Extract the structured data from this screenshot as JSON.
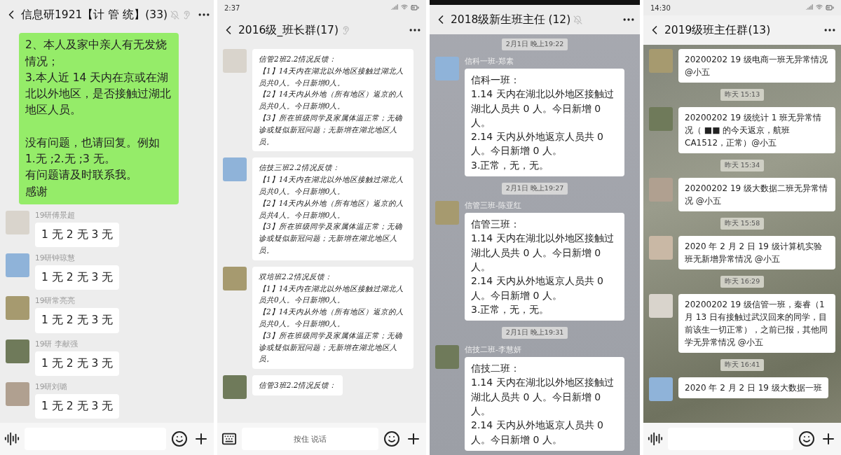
{
  "panels": [
    {
      "kind": "light",
      "title": "信息研1921【计 管 统】(33)",
      "muted": true,
      "ear": true,
      "messages": [
        {
          "kind": "outgoing",
          "paragraphs": [
            [
              "2、本人及家中亲人有无发烧情况；",
              "3.本人近 14 天内在京或在湖北以外地区，是否接触过湖北地区人员。"
            ],
            [
              "没有问题，也请回复。例如 1.无 ;2.无 ;3 无。",
              "有问题请及时联系我。",
              "感谢"
            ]
          ]
        },
        {
          "kind": "incoming",
          "sender": "19研傅景超",
          "paragraphs": [
            [
              "1 无 2 无 3 无"
            ]
          ]
        },
        {
          "kind": "incoming",
          "sender": "19研钟琼慧",
          "paragraphs": [
            [
              "1 无 2 无 3 无"
            ]
          ]
        },
        {
          "kind": "incoming",
          "sender": "19研常亮亮",
          "paragraphs": [
            [
              "1 无 2 无 3 无"
            ]
          ]
        },
        {
          "kind": "incoming",
          "sender": "19研 李献强",
          "paragraphs": [
            [
              "1 无 2 无 3 无"
            ]
          ]
        },
        {
          "kind": "incoming",
          "sender": "19研刘璐",
          "paragraphs": [
            [
              "1 无 2 无 3 无"
            ]
          ]
        }
      ],
      "input": {
        "kind": "voice"
      }
    },
    {
      "kind": "handwritten",
      "status_time": "2:37",
      "title": "2016级_班长群(17)",
      "ear": true,
      "messages": [
        {
          "kind": "incoming",
          "paragraphs": [
            [
              "信管2班2.2情况反馈：",
              "【1】14天内在湖北以外地区接触过湖北人员共0人。今日新增0人。",
              "【2】14天内从外地（所有地区）返京的人员共0人。今日新增0人。",
              "【3】所在班级同学及家属体温正常；无确诊或疑似新冠问题；无新增在湖北地区人员。"
            ]
          ]
        },
        {
          "kind": "incoming",
          "paragraphs": [
            [
              "信技三班2.2情况反馈：",
              "【1】14天内在湖北以外地区接触过湖北人员共0人。今日新增0人。",
              "【2】14天内从外地（所有地区）返京的人员共4人。今日新增0人。",
              "【3】所在班级同学及家属体温正常；无确诊或疑似新冠问题；无新增在湖北地区人员。"
            ]
          ]
        },
        {
          "kind": "incoming",
          "paragraphs": [
            [
              "双培班2.2情况反馈：",
              "【1】14天内在湖北以外地区接触过湖北人员共0人。今日新增0人。",
              "【2】14天内从外地（所有地区）返京的人员共0人。今日新增0人。",
              "【3】所在班级同学及家属体温正常；无确诊或疑似新冠问题；无新增在湖北地区人员。"
            ]
          ]
        },
        {
          "kind": "incoming",
          "paragraphs": [
            [
              "信管3班2.2情况反馈："
            ]
          ]
        }
      ],
      "input": {
        "kind": "keyboard",
        "placeholder": "按住 说话"
      }
    },
    {
      "kind": "ink",
      "title": "2018级新生班主任",
      "count": "(12)",
      "muted": true,
      "messages": [
        {
          "kind": "time",
          "text": "2月1日 晚上19:22"
        },
        {
          "kind": "incoming",
          "sender": "信科一班-郑素",
          "paragraphs": [
            [
              "信科一班：",
              "1.14 天内在湖北以外地区接触过湖北人员共 0 人。今日新增 0 人。",
              "2.14 天内从外地返京人员共 0 人。今日新增 0 人。",
              "3.正常，无，无。"
            ]
          ]
        },
        {
          "kind": "time",
          "text": "2月1日 晚上19:27"
        },
        {
          "kind": "incoming",
          "sender": "信管三班-陈亚红",
          "paragraphs": [
            [
              "信管三班：",
              "1.14 天内在湖北以外地区接触过湖北人员共 0 人。今日新增 0 人。",
              "2.14 天内从外地返京人员共 0 人。今日新增 0 人。",
              "3.正常，无，无。"
            ]
          ]
        },
        {
          "kind": "time",
          "text": "2月1日 晚上19:31"
        },
        {
          "kind": "incoming",
          "sender": "信技二班-李慧妍",
          "paragraphs": [
            [
              "信技二班：",
              "1.14 天内在湖北以外地区接触过湖北人员共 0 人。今日新增 0 人。",
              "2.14 天内从外地返京人员共 0 人。今日新增 0 人。"
            ]
          ]
        }
      ]
    },
    {
      "kind": "rain",
      "status_time": "14:30",
      "title": "2019级班主任群(13)",
      "messages": [
        {
          "kind": "incoming",
          "paragraphs": [
            [
              "20200202 19 级电商一班无异常情况 @小五"
            ]
          ]
        },
        {
          "kind": "time",
          "text": "昨天 15:13"
        },
        {
          "kind": "incoming",
          "paragraphs": [
            [
              "20200202 19 级统计 1 班无异常情况（ ■■ 的今天返京，航班 CA1512，正常）@小五"
            ]
          ]
        },
        {
          "kind": "time",
          "text": "昨天 15:34"
        },
        {
          "kind": "incoming",
          "paragraphs": [
            [
              "20200202 19 级大数据二班无异常情况 @小五"
            ]
          ]
        },
        {
          "kind": "time",
          "text": "昨天 15:58"
        },
        {
          "kind": "incoming",
          "paragraphs": [
            [
              "2020 年 2 月 2 日 19 级计算机实验班无新增异常情况 @小五"
            ]
          ]
        },
        {
          "kind": "time",
          "text": "昨天 16:29"
        },
        {
          "kind": "incoming",
          "paragraphs": [
            [
              "20200202 19 级信管一班，秦睿（1 月 13 日有接触过武汉回来的同学，目前该生一切正常），之前已报，其他同学无异常情况 @小五"
            ]
          ]
        },
        {
          "kind": "time",
          "text": "昨天 16:41"
        },
        {
          "kind": "incoming",
          "paragraphs": [
            [
              "2020 年 2 月 2 日 19 级大数据一班"
            ]
          ]
        }
      ],
      "input": {
        "kind": "voice"
      }
    }
  ]
}
